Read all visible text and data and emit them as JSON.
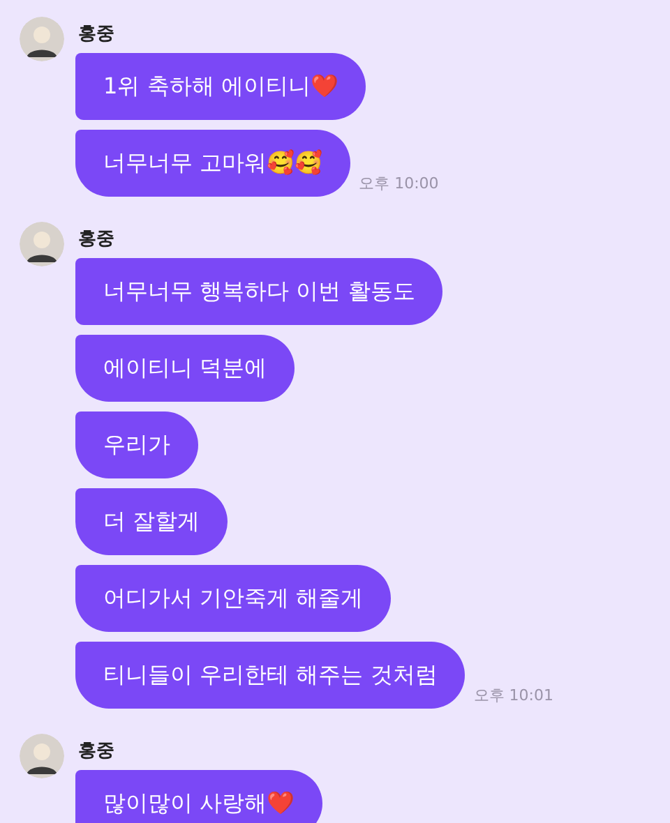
{
  "groups": [
    {
      "sender": "홍중",
      "messages": [
        "1위 축하해 에이티니❤️",
        "너무너무 고마워🥰🥰"
      ],
      "time": "오후 10:00"
    },
    {
      "sender": "홍중",
      "messages": [
        "너무너무 행복하다 이번 활동도",
        "에이티니 덕분에",
        "우리가",
        "더 잘할게",
        "어디가서 기안죽게 해줄게",
        "티니들이 우리한테 해주는 것처럼"
      ],
      "time": "오후 10:01"
    },
    {
      "sender": "홍중",
      "messages": [
        "많이많이 사랑해❤️"
      ]
    }
  ]
}
